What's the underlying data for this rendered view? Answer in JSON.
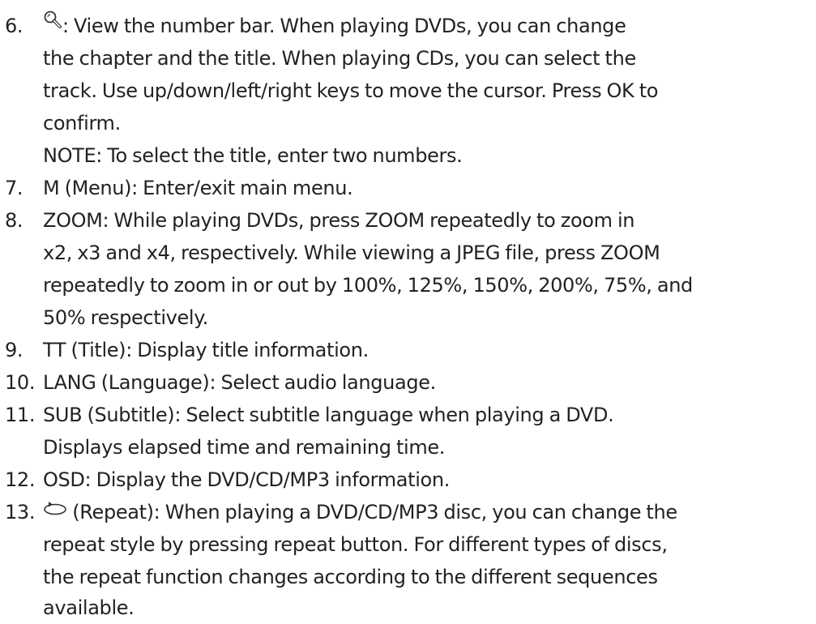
{
  "items": [
    {
      "number": "6.",
      "icon": "magnifier-search-icon",
      "lines": [
        ": View the number bar. When playing DVDs, you can change",
        "the chapter and the title. When playing CDs, you can select the",
        "track. Use up/down/left/right keys to move the cursor. Press OK to",
        "confirm.",
        "NOTE: To select the title, enter two numbers."
      ]
    },
    {
      "number": "7.",
      "lines": [
        "M (Menu): Enter/exit main menu."
      ]
    },
    {
      "number": "8.",
      "lines": [
        "ZOOM: While playing DVDs, press ZOOM repeatedly to zoom in",
        "x2, x3 and x4, respectively. While viewing a JPEG file, press ZOOM",
        "repeatedly to zoom in or out by 100%, 125%, 150%, 200%, 75%, and",
        "50% respectively."
      ]
    },
    {
      "number": "9.",
      "lines": [
        "TT (Title): Display title information."
      ]
    },
    {
      "number": "10.",
      "lines": [
        "LANG (Language): Select audio language."
      ]
    },
    {
      "number": "11.",
      "lines": [
        "SUB (Subtitle): Select subtitle language when playing a DVD.",
        "Displays elapsed time and remaining time."
      ]
    },
    {
      "number": "12.",
      "lines": [
        "OSD: Display the DVD/CD/MP3 information."
      ]
    },
    {
      "number": "13.",
      "icon": "repeat-icon",
      "lines": [
        " (Repeat): When playing a DVD/CD/MP3 disc, you can change the",
        "repeat style by pressing repeat button. For different types of discs,",
        "the repeat function changes according to the different sequences",
        "available."
      ]
    }
  ]
}
